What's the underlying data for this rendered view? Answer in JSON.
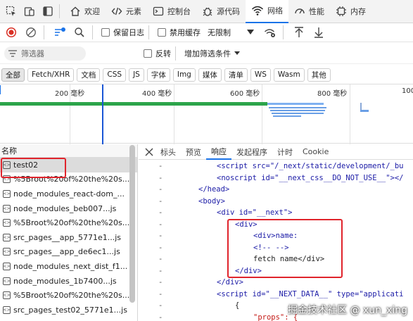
{
  "tabbar": {
    "tabs": [
      {
        "label": "欢迎",
        "icon": "home-icon"
      },
      {
        "label": "元素",
        "icon": "code-icon"
      },
      {
        "label": "控制台",
        "icon": "console-icon"
      },
      {
        "label": "源代码",
        "icon": "bug-icon"
      },
      {
        "label": "网络",
        "icon": "wifi-icon",
        "active": true
      },
      {
        "label": "性能",
        "icon": "performance-icon"
      },
      {
        "label": "内存",
        "icon": "memory-icon"
      }
    ]
  },
  "toolbar": {
    "preserve_log": "保留日志",
    "disable_cache": "禁用缓存",
    "throttle": "无限制"
  },
  "filter": {
    "placeholder": "筛选器",
    "invert": "反转",
    "more_filters": "增加筛选条件"
  },
  "types": [
    "全部",
    "Fetch/XHR",
    "文档",
    "CSS",
    "JS",
    "字体",
    "Img",
    "媒体",
    "清单",
    "WS",
    "Wasm",
    "其他"
  ],
  "overview": {
    "ticks": [
      "200 毫秒",
      "400 毫秒",
      "600 毫秒",
      "800 毫秒",
      "100"
    ]
  },
  "requests": {
    "header": "名称",
    "items": [
      "test02",
      "%5Broot%20of%20the%20s...",
      "node_modules_react-dom_...",
      "node_modules_beb007...js",
      "%5Broot%20of%20the%20s...",
      "src_pages__app_5771e1...js",
      "src_pages__app_de6ec1...js",
      "node_modules_next_dist_f1...",
      "node_modules_1b7400...js",
      "%5Broot%20of%20the%20s...",
      "src_pages_test02_5771e1...js"
    ]
  },
  "details": {
    "tabs": [
      "标头",
      "预览",
      "响应",
      "发起程序",
      "计时",
      "Cookie"
    ],
    "active_tab": "响应"
  },
  "code_lines": [
    {
      "gutter": "-",
      "indent": 2,
      "html": "<script src=\"/_next/static/development/_bu"
    },
    {
      "gutter": "-",
      "indent": 2,
      "html": "<noscript id=\"__next_css__DO_NOT_USE__\"></"
    },
    {
      "gutter": "-",
      "indent": 1,
      "html": "</head>"
    },
    {
      "gutter": "-",
      "indent": 1,
      "html": "<body>"
    },
    {
      "gutter": "-",
      "indent": 2,
      "html": "<div id=\"__next\">"
    },
    {
      "gutter": "-",
      "indent": 3,
      "html": "<div>"
    },
    {
      "gutter": "-",
      "indent": 4,
      "html": "<div>name:"
    },
    {
      "gutter": "-",
      "indent": 4,
      "html": "<!-- -->"
    },
    {
      "gutter": "-",
      "indent": 4,
      "html": "fetch name</div>"
    },
    {
      "gutter": "-",
      "indent": 3,
      "html": "</div>"
    },
    {
      "gutter": "-",
      "indent": 2,
      "html": "</div>"
    },
    {
      "gutter": "-",
      "indent": 2,
      "html": "<script id=\"__NEXT_DATA__\" type=\"applicati"
    },
    {
      "gutter": "-",
      "indent": 3,
      "html": "{"
    },
    {
      "gutter": "-",
      "indent": 4,
      "html": "\"props\": {"
    }
  ],
  "watermark": "掘金技术社区 @ xun_xing",
  "colors": {
    "accent": "#1a73e8",
    "highlight": "#e0242c",
    "stop": "#d93025"
  }
}
